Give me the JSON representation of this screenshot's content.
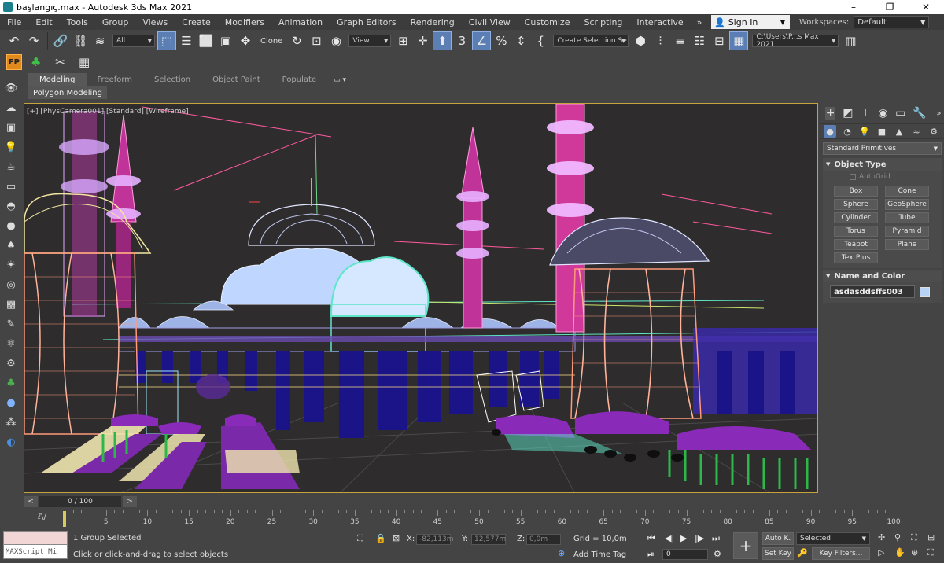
{
  "window": {
    "title": "başlangıç.max - Autodesk 3ds Max 2021"
  },
  "menu": {
    "items": [
      "File",
      "Edit",
      "Tools",
      "Group",
      "Views",
      "Create",
      "Modifiers",
      "Animation",
      "Graph Editors",
      "Rendering",
      "Civil View",
      "Customize",
      "Scripting",
      "Interactive"
    ],
    "overflow": "»",
    "signin": "Sign In",
    "workspaces_label": "Workspaces:",
    "workspace": "Default"
  },
  "toolbar": {
    "selection_filter": "All",
    "clone_label": "Clone",
    "ref_coord": "View",
    "named_selection": "Create Selection Se",
    "project_path": "C:\\Users\\P...s Max 2021"
  },
  "ribbon": {
    "tabs": [
      "Modeling",
      "Freeform",
      "Selection",
      "Object Paint",
      "Populate"
    ],
    "panel": "Polygon Modeling"
  },
  "viewport": {
    "label": "[+] [PhysCamera001] [Standard] [Wireframe]"
  },
  "command_panel": {
    "category": "Standard Primitives",
    "object_type_title": "Object Type",
    "autogrid": "AutoGrid",
    "buttons": [
      "Box",
      "Cone",
      "Sphere",
      "GeoSphere",
      "Cylinder",
      "Tube",
      "Torus",
      "Pyramid",
      "Teapot",
      "Plane",
      "TextPlus"
    ],
    "name_color_title": "Name and Color",
    "object_name": "asdasddsffs003",
    "object_color": "#b7d2f3"
  },
  "timeline": {
    "frame_display": "0 / 100",
    "ticks": [
      5,
      10,
      15,
      20,
      25,
      30,
      35,
      40,
      45,
      50,
      55,
      60,
      65,
      70,
      75,
      80,
      85,
      90,
      95,
      100
    ]
  },
  "status": {
    "selection": "1 Group Selected",
    "prompt": "Click or click-and-drag to select objects",
    "maxscript": "MAXScript Mi",
    "x_label": "X:",
    "x_value": "-82,113m",
    "y_label": "Y:",
    "y_value": "12,577m",
    "z_label": "Z:",
    "z_value": "0,0m",
    "grid": "Grid = 10,0m",
    "add_time_tag": "Add Time Tag",
    "auto_key": "Auto K.",
    "set_key": "Set Key",
    "key_mode": "Selected",
    "key_filters": "Key Filters...",
    "frame": "0"
  }
}
